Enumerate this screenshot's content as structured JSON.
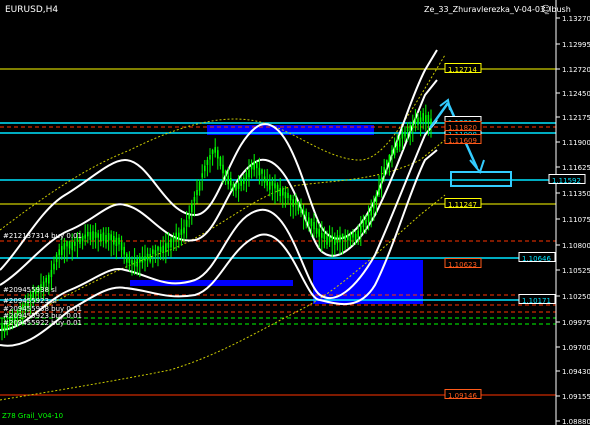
{
  "chart_title": "EURUSD,H4",
  "indicator_title": "Ze_33_Zhuravlerezka_V-04-03_Ibush",
  "footer_label": "Z78 Grail_V04-10",
  "price_axis": [
    "1.13270",
    "1.12995",
    "1.12720",
    "1.12450",
    "1.12175",
    "1.11900",
    "1.11625",
    "1.11350",
    "1.11075",
    "1.10800",
    "1.10525",
    "1.10250",
    "1.09975",
    "1.09700",
    "1.09430",
    "1.09155",
    "1.08880"
  ],
  "level_labels": [
    {
      "text": "1.12714",
      "color": "#ffff00",
      "border": "#ffff00"
    },
    {
      "text": "1.12216",
      "color": "#00e5ff",
      "border": "#ffffff"
    },
    {
      "text": "1.11998",
      "color": "#00e5ff",
      "border": "#ffffff"
    },
    {
      "text": "1.11820",
      "color": "#ff5a1a",
      "border": "#ff5a1a"
    },
    {
      "text": "1.11609",
      "color": "#ff5a1a",
      "border": "#ff5a1a"
    },
    {
      "text": "1.11592",
      "color": "#00e5ff",
      "border": "#ffffff"
    },
    {
      "text": "1.11247",
      "color": "#ffff00",
      "border": "#ffff00"
    },
    {
      "text": "1.10646",
      "color": "#00e5ff",
      "border": "#ffffff"
    },
    {
      "text": "1.10623",
      "color": "#ff5a1a",
      "border": "#ff5a1a"
    },
    {
      "text": "1.10171",
      "color": "#00e5ff",
      "border": "#ffffff"
    },
    {
      "text": "1.09146",
      "color": "#ff5a1a",
      "border": "#ff5a1a"
    }
  ],
  "order_labels": [
    "#212137314 buy 0.01",
    "#209455938 sl",
    "#209455923 sl",
    "#209455938 buy 0.01",
    "#209455923 buy 0.01",
    "#209455922 buy 0.01"
  ],
  "colors": {
    "background": "#000000",
    "candles": "#00ff00",
    "bands": "#ffffff",
    "zones": "#0000ff",
    "arrow": "#33ccff",
    "level_cyan": "#00e5ff",
    "level_yellow": "#ffff00",
    "level_red": "#ff3300"
  }
}
